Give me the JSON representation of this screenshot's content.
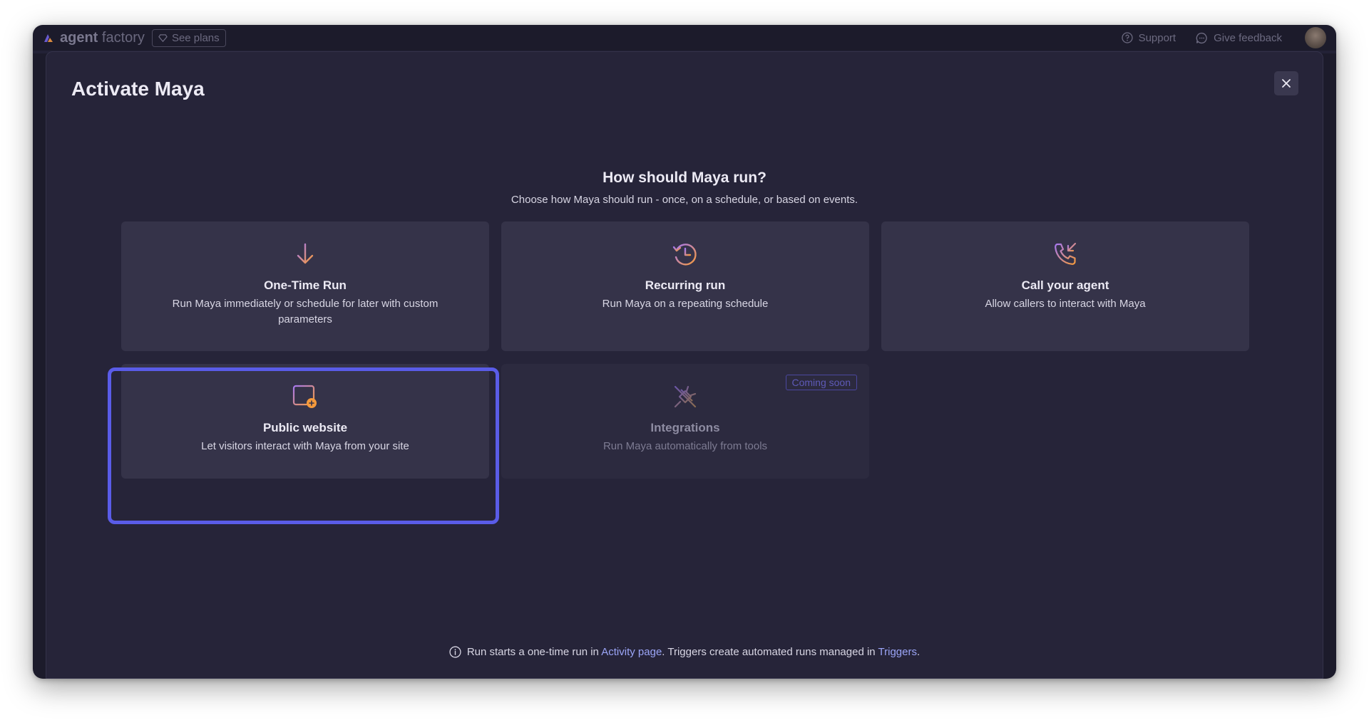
{
  "topbar": {
    "brand_bold": "agent",
    "brand_light": "factory",
    "see_plans": "See plans",
    "support": "Support",
    "give_feedback": "Give feedback"
  },
  "modal": {
    "title": "Activate Maya",
    "question": "How should Maya run?",
    "subtitle": "Choose how Maya should run - once, on a schedule, or based on events.",
    "cards": [
      {
        "icon": "arrow-down-icon",
        "title": "One-Time Run",
        "desc": "Run Maya immediately or schedule for later with custom parameters"
      },
      {
        "icon": "recurring-clock-icon",
        "title": "Recurring run",
        "desc": "Run Maya on a repeating schedule"
      },
      {
        "icon": "phone-incoming-icon",
        "title": "Call your agent",
        "desc": "Allow callers to interact with Maya"
      },
      {
        "icon": "website-browser-icon",
        "title": "Public website",
        "desc": "Let visitors interact with Maya from your site"
      },
      {
        "icon": "plug-disconnected-icon",
        "title": "Integrations",
        "desc": "Run Maya automatically from tools",
        "badge": "Coming soon"
      }
    ],
    "footer": {
      "part1": "Run starts a one-time run in ",
      "link1": "Activity page",
      "part2": ". Triggers create automated runs managed in ",
      "link2": "Triggers",
      "part3": "."
    }
  },
  "colors": {
    "accent_highlight": "#5a5ce8",
    "link": "#9ba5f7",
    "icon_gradient_start": "#a778f0",
    "icon_gradient_end": "#f59a3c"
  }
}
